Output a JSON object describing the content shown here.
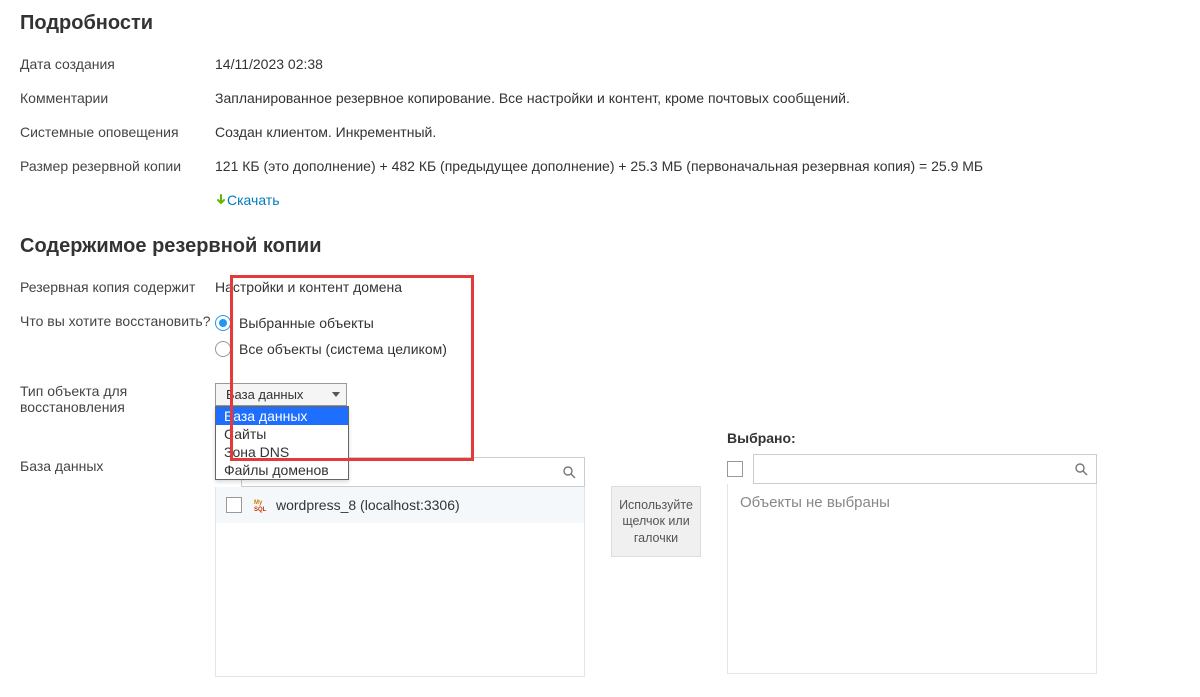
{
  "details": {
    "heading": "Подробности",
    "created_label": "Дата создания",
    "created_value": "14/11/2023 02:38",
    "comments_label": "Комментарии",
    "comments_value": "Запланированное резервное копирование. Все настройки и контент, кроме почтовых сообщений.",
    "system_label": "Системные оповещения",
    "system_value": "Создан клиентом. Инкрементный.",
    "size_label": "Размер резервной копии",
    "size_value": "121 КБ (это дополнение) + 482 КБ (предыдущее дополнение) + 25.3 МБ (первоначальная резервная копия) = 25.9 МБ",
    "download_label": "Скачать"
  },
  "content": {
    "heading": "Содержимое резервной копии",
    "contains_label": "Резервная копия содержит",
    "contains_value": "Настройки и контент домена",
    "restore_label": "Что вы хотите восстановить?",
    "radio_selected": "Выбранные объекты",
    "radio_all": "Все объекты (система целиком)",
    "type_label": "Тип объекта для восстановления",
    "select_value": "База данных",
    "dropdown": {
      "opt0": "База данных",
      "opt1": "Сайты",
      "opt2": "Зона DNS",
      "opt3": "Файлы доменов"
    },
    "db_label": "База данных",
    "selected_heading": "Выбрано:",
    "hint": "Используйте щелчок или галочки",
    "empty_text": "Объекты не выбраны",
    "list_item": "wordpress_8 (localhost:3306)"
  }
}
